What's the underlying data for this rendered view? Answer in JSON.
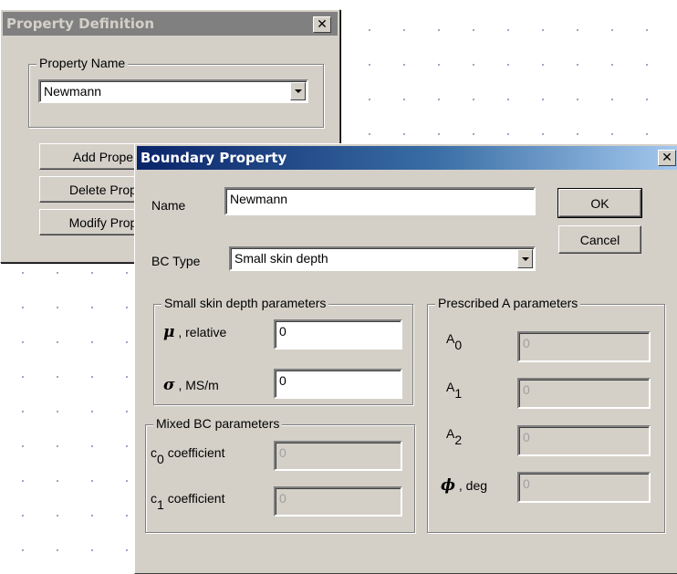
{
  "property_definition": {
    "title": "Property Definition",
    "close_glyph": "✕",
    "group_label": "Property Name",
    "selected_property": "Newmann",
    "buttons": {
      "add": "Add Prope",
      "delete": "Delete Prop",
      "modify": "Modify Prop"
    }
  },
  "boundary_property": {
    "title": "Boundary Property",
    "close_glyph": "✕",
    "name_label": "Name",
    "name_value": "Newmann",
    "ok_label": "OK",
    "cancel_label": "Cancel",
    "bc_type_label": "BC Type",
    "bc_type_value": "Small skin depth",
    "small_skin": {
      "legend": "Small skin depth parameters",
      "mu_symbol": "μ",
      "mu_label": ", relative",
      "mu_value": "0",
      "sigma_symbol": "σ",
      "sigma_label": ", MS/m",
      "sigma_value": "0"
    },
    "mixed": {
      "legend": "Mixed BC parameters",
      "c0_base": "c",
      "c0_sub": "0",
      "c0_label": "coefficient",
      "c0_value": "0",
      "c1_base": "c",
      "c1_sub": "1",
      "c1_label": "coefficient",
      "c1_value": "0"
    },
    "prescribed": {
      "legend": "Prescribed A parameters",
      "a0_base": "A",
      "a0_sub": "0",
      "a0_value": "0",
      "a1_base": "A",
      "a1_sub": "1",
      "a1_value": "0",
      "a2_base": "A",
      "a2_sub": "2",
      "a2_value": "0",
      "phi_symbol": "ϕ",
      "phi_label": ", deg",
      "phi_value": "0"
    }
  }
}
